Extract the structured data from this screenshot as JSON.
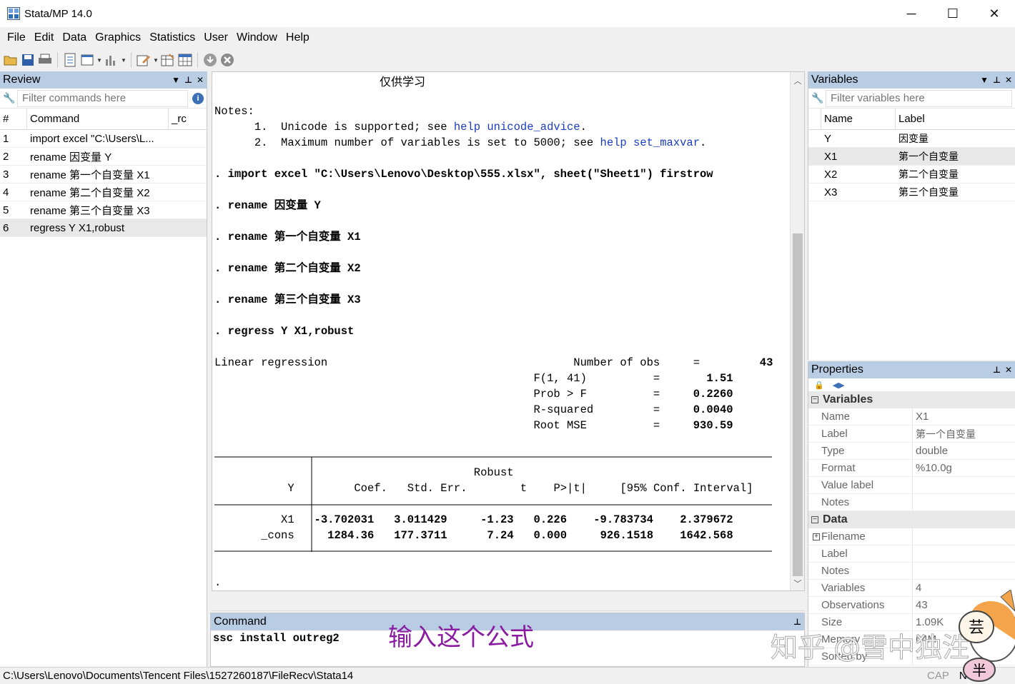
{
  "window": {
    "title": "Stata/MP 14.0",
    "minimize": "─",
    "maximize": "☐",
    "close": "✕"
  },
  "menu": [
    "File",
    "Edit",
    "Data",
    "Graphics",
    "Statistics",
    "User",
    "Window",
    "Help"
  ],
  "review": {
    "title": "Review",
    "filter_placeholder": "Filter commands here",
    "columns": [
      "#",
      "Command",
      "_rc"
    ],
    "rows": [
      {
        "num": "1",
        "cmd": "import excel \"C:\\Users\\L..."
      },
      {
        "num": "2",
        "cmd": "rename 因变量 Y"
      },
      {
        "num": "3",
        "cmd": "rename 第一个自变量 X1"
      },
      {
        "num": "4",
        "cmd": "rename 第二个自变量 X2"
      },
      {
        "num": "5",
        "cmd": "rename 第三个自变量 X3"
      },
      {
        "num": "6",
        "cmd": "regress Y X1,robust"
      }
    ]
  },
  "results": {
    "banner": "仅供学习",
    "notes_label": "Notes:",
    "note1_num": "1.",
    "note1_pre": "Unicode is supported; see ",
    "note1_link": "help unicode_advice",
    "note2_num": "2.",
    "note2_pre": "Maximum number of variables is set to 5000; see ",
    "note2_link": "help set_maxvar",
    "cmd1": ". import excel \"C:\\Users\\Lenovo\\Desktop\\555.xlsx\", sheet(\"Sheet1\") firstrow",
    "cmd2": ". rename 因变量 Y",
    "cmd3": ". rename 第一个自变量 X1",
    "cmd4": ". rename 第二个自变量 X2",
    "cmd5": ". rename 第三个自变量 X3",
    "cmd6": ". regress Y X1,robust",
    "model_title": "Linear regression",
    "stats": [
      {
        "label": "Number of obs",
        "eq": "=",
        "value": "43"
      },
      {
        "label": "F(1, 41)",
        "eq": "=",
        "value": "1.51"
      },
      {
        "label": "Prob > F",
        "eq": "=",
        "value": "0.2260"
      },
      {
        "label": "R-squared",
        "eq": "=",
        "value": "0.0040"
      },
      {
        "label": "Root MSE",
        "eq": "=",
        "value": "930.59"
      }
    ],
    "table": {
      "header_top": "Robust",
      "columns": [
        "Y",
        "Coef.",
        "Std. Err.",
        "t",
        "P>|t|",
        "[95% Conf.",
        "Interval]"
      ],
      "rows": [
        {
          "var": "X1",
          "coef": "-3.702031",
          "se": "3.011429",
          "t": "-1.23",
          "p": "0.226",
          "lo": "-9.783734",
          "hi": "2.379672"
        },
        {
          "var": "_cons",
          "coef": "1284.36",
          "se": "177.3711",
          "t": "7.24",
          "p": "0.000",
          "lo": "926.1518",
          "hi": "1642.568"
        }
      ]
    },
    "prompt": "."
  },
  "command": {
    "title": "Command",
    "value": "ssc install outreg2",
    "annotation": "输入这个公式"
  },
  "variables": {
    "title": "Variables",
    "filter_placeholder": "Filter variables here",
    "columns": [
      "Name",
      "Label"
    ],
    "rows": [
      {
        "name": "Y",
        "label": "因变量"
      },
      {
        "name": "X1",
        "label": "第一个自变量"
      },
      {
        "name": "X2",
        "label": "第二个自变量"
      },
      {
        "name": "X3",
        "label": "第三个自变量"
      }
    ]
  },
  "properties": {
    "title": "Properties",
    "var_section": "Variables",
    "var_rows": [
      {
        "key": "Name",
        "value": "X1"
      },
      {
        "key": "Label",
        "value": "第一个自变量"
      },
      {
        "key": "Type",
        "value": "double"
      },
      {
        "key": "Format",
        "value": "%10.0g"
      },
      {
        "key": "Value label",
        "value": ""
      },
      {
        "key": "Notes",
        "value": ""
      }
    ],
    "data_section": "Data",
    "data_rows": [
      {
        "key": "Filename",
        "value": ""
      },
      {
        "key": "Label",
        "value": ""
      },
      {
        "key": "Notes",
        "value": ""
      },
      {
        "key": "Variables",
        "value": "4"
      },
      {
        "key": "Observations",
        "value": "43"
      },
      {
        "key": "Size",
        "value": "1.09K"
      },
      {
        "key": "Memory",
        "value": "64M"
      },
      {
        "key": "Sorted by",
        "value": ""
      }
    ]
  },
  "status": {
    "path": "C:\\Users\\Lenovo\\Documents\\Tencent Files\\1527260187\\FileRecv\\Stata14",
    "cap": "CAP",
    "num": "NUM"
  },
  "watermark": "知乎 @雪中独泩"
}
